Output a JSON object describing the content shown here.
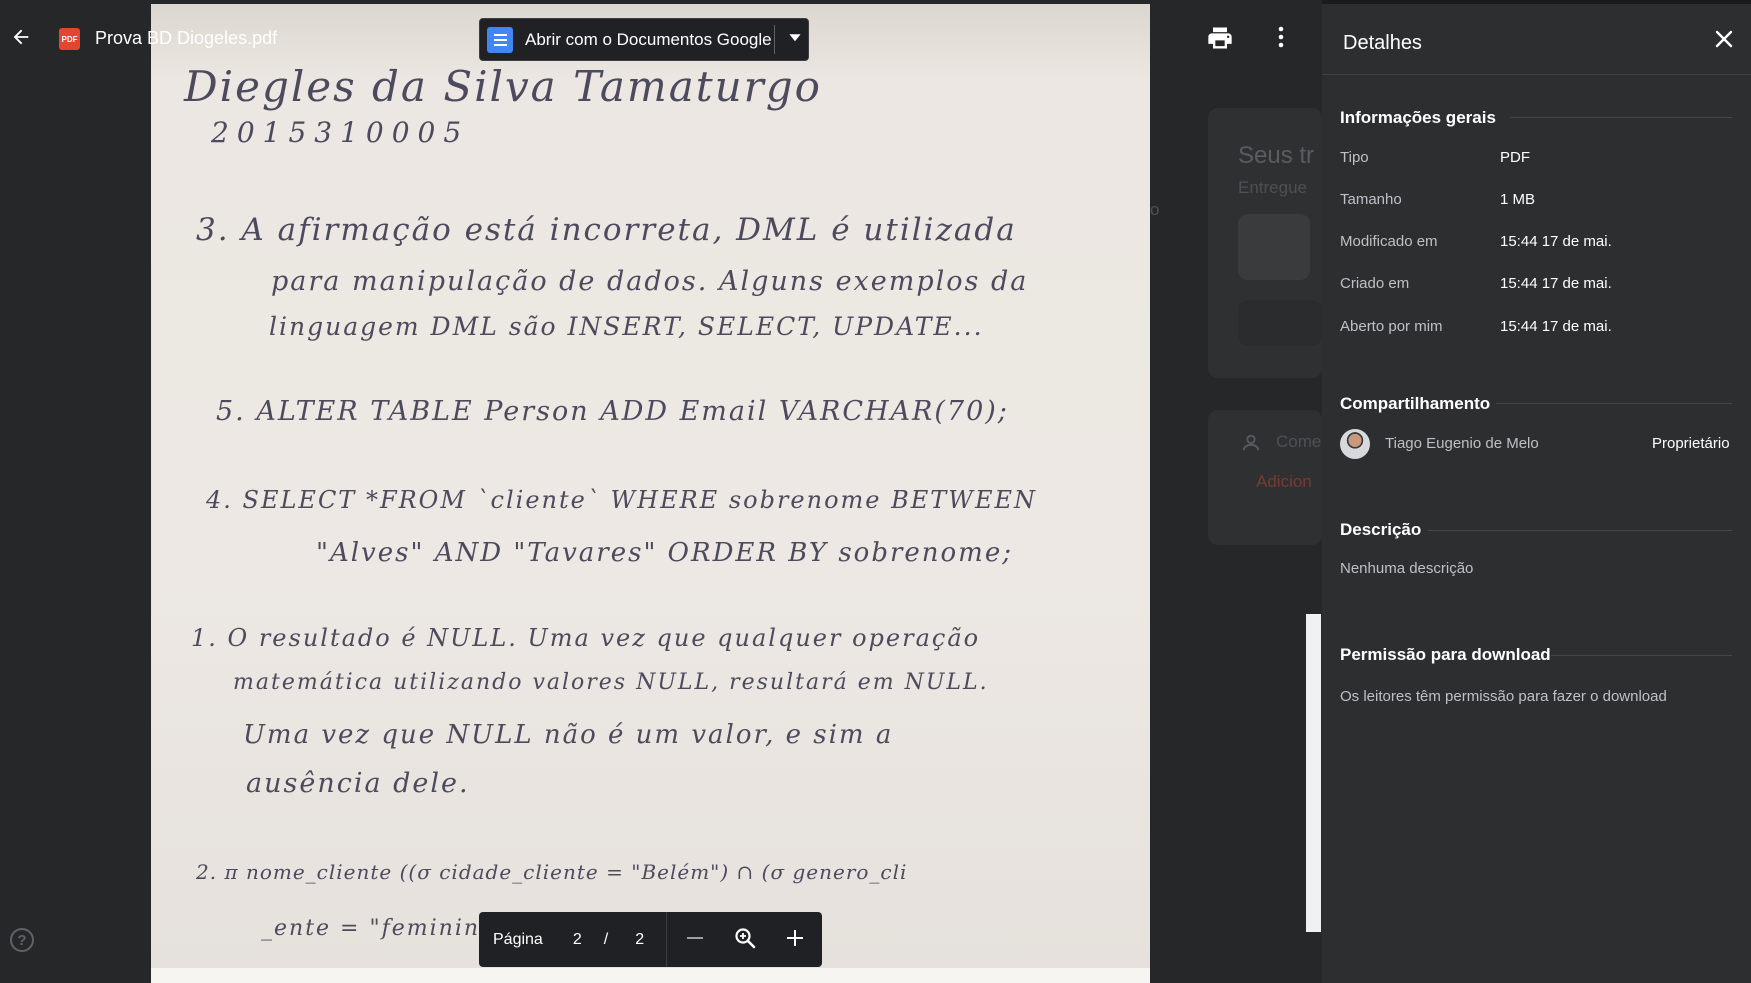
{
  "header": {
    "file_name": "Prova BD Diogeles.pdf",
    "file_type_icon": "pdf-file-icon",
    "file_type_badge": "PDF",
    "open_with_label": "Abrir com o Documentos Google"
  },
  "document": {
    "lines": [
      "Diegles da Silva Tamaturgo",
      "2015310005",
      "3. A afirmação está incorreta, DML é utilizada",
      "para manipulação de dados. Alguns exemplos da",
      "linguagem DML são INSERT, SELECT, UPDATE...",
      "5. ALTER TABLE Person ADD Email VARCHAR(70);",
      "4. SELECT *FROM `cliente` WHERE sobrenome BETWEEN",
      "\"Alves\" AND \"Tavares\" ORDER BY sobrenome;",
      "1. O resultado é NULL. Uma vez que qualquer operação",
      "matemática utilizando valores NULL, resultará em NULL.",
      "Uma vez que NULL não é um valor, e sim a",
      "ausência dele.",
      "2. π nome_cliente ((σ cidade_cliente = \"Belém\") ∩ (σ genero_cli",
      "_ente = \"feminino\"))"
    ]
  },
  "page_controls": {
    "label": "Página",
    "current": "2",
    "separator": "/",
    "total": "2"
  },
  "background": {
    "heading": "Seus tr",
    "subheading": "Entregue",
    "comment_label": "Come",
    "add_label": "Adicion",
    "side_text": "o"
  },
  "details": {
    "title": "Detalhes",
    "general_title": "Informações gerais",
    "general": [
      {
        "label": "Tipo",
        "value": "PDF"
      },
      {
        "label": "Tamanho",
        "value": "1 MB"
      },
      {
        "label": "Modificado em",
        "value": "15:44 17 de mai."
      },
      {
        "label": "Criado em",
        "value": "15:44 17 de mai."
      },
      {
        "label": "Aberto por mim",
        "value": "15:44 17 de mai."
      }
    ],
    "sharing_title": "Compartilhamento",
    "owner_name": "Tiago Eugenio de Melo",
    "owner_role": "Proprietário",
    "description_title": "Descrição",
    "description_text": "Nenhuma descrição",
    "download_title": "Permissão para download",
    "download_text": "Os leitores têm permissão para fazer o download"
  },
  "icons": {
    "back": "arrow-back-icon",
    "print": "print-icon",
    "more": "more-vert-icon",
    "close": "close-icon",
    "zoom_out": "minus-icon",
    "zoom": "zoom-icon",
    "zoom_in": "plus-icon",
    "help": "help-icon"
  },
  "colors": {
    "pdf_red": "#e5452f",
    "docs_blue": "#4285f4",
    "panel_bg": "#2d2e30"
  }
}
